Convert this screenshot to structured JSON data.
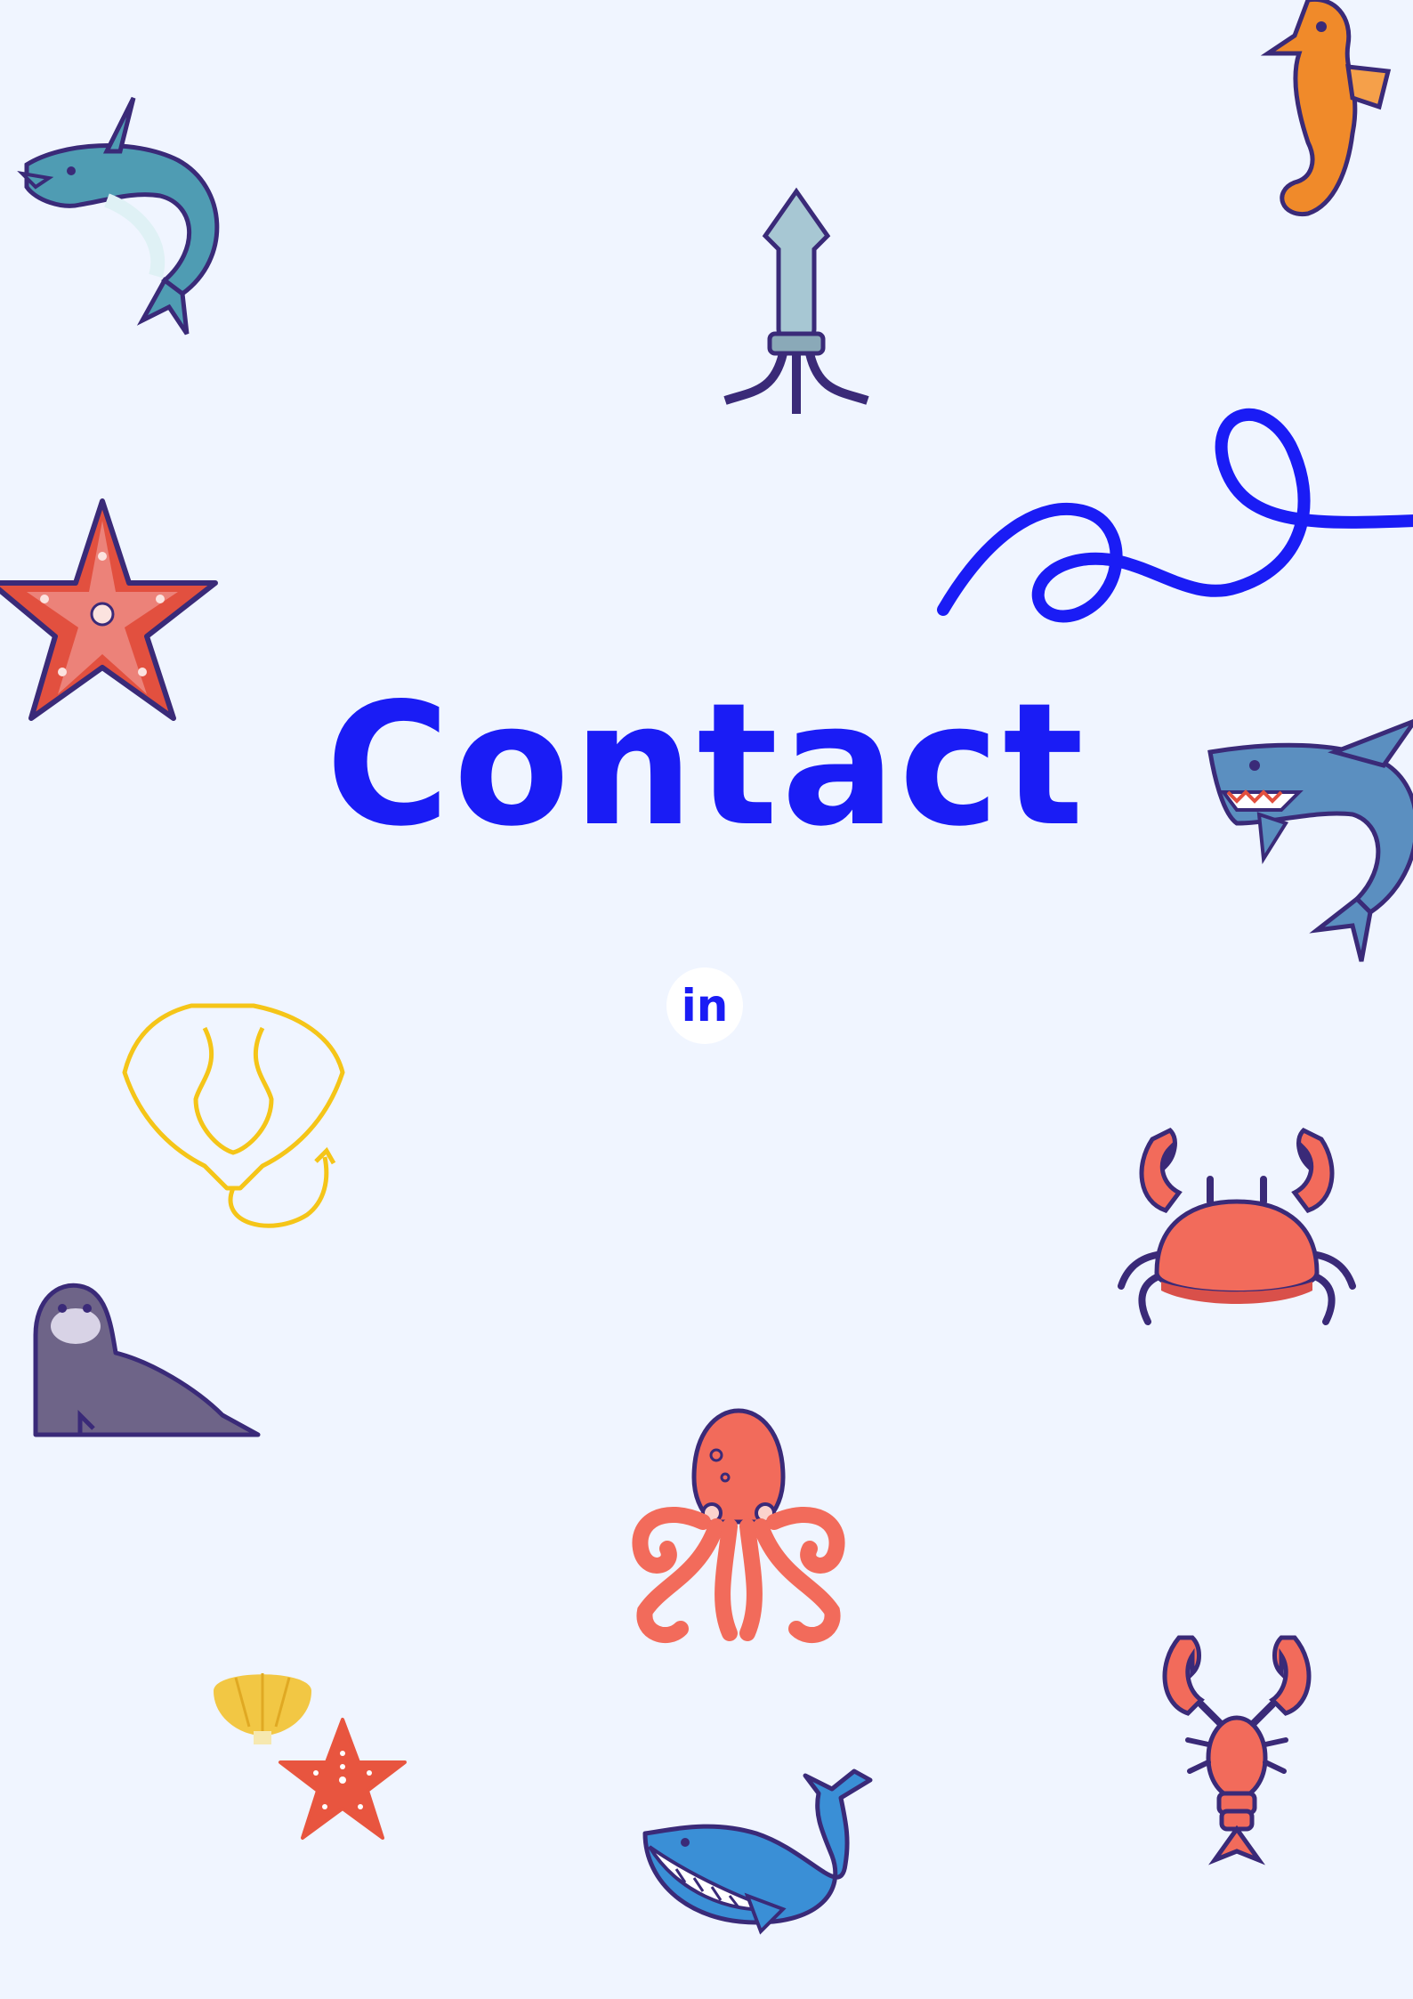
{
  "page": {
    "title": "Contact",
    "background_color": "#f0f5ff",
    "accent_color": "#1a1cf5"
  },
  "social": {
    "linkedin_label": "in",
    "icon": "linkedin-icon"
  },
  "decorations": [
    {
      "name": "dolphin-icon",
      "color": "#4f9cb3"
    },
    {
      "name": "squid-icon",
      "color": "#a7c7d3"
    },
    {
      "name": "seahorse-icon",
      "color": "#f08a2a"
    },
    {
      "name": "squiggle-line",
      "color": "#1a1cf5"
    },
    {
      "name": "starfish-icon",
      "color": "#e2503f"
    },
    {
      "name": "shark-icon",
      "color": "#5b8fc0"
    },
    {
      "name": "stingray-icon",
      "color": "#f5c518"
    },
    {
      "name": "crab-icon",
      "color": "#f26b5b"
    },
    {
      "name": "seal-icon",
      "color": "#6e6488"
    },
    {
      "name": "octopus-icon",
      "color": "#f26b5b"
    },
    {
      "name": "lobster-icon",
      "color": "#f26b5b"
    },
    {
      "name": "shell-icon",
      "color": "#f2c744"
    },
    {
      "name": "small-starfish-icon",
      "color": "#e8553f"
    },
    {
      "name": "whale-icon",
      "color": "#3a8fd6"
    }
  ]
}
